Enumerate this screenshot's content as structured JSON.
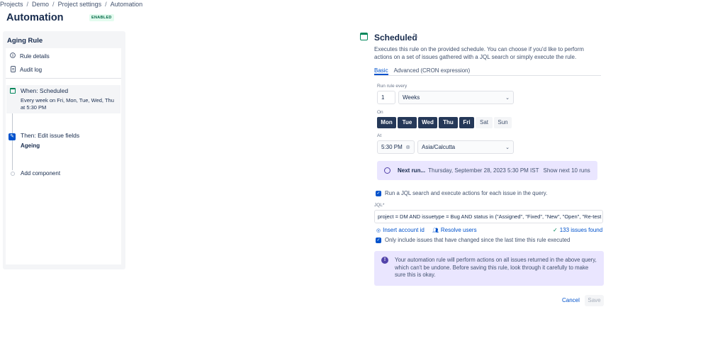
{
  "breadcrumb": {
    "items": [
      "Projects",
      "Demo",
      "Project settings",
      "Automation"
    ]
  },
  "page": {
    "title": "Automation",
    "status_badge": "ENABLED"
  },
  "sidebar": {
    "title": "Aging Rule",
    "items": [
      {
        "label": "Rule details",
        "icon": "info-icon"
      },
      {
        "label": "Audit log",
        "icon": "document-icon"
      }
    ],
    "trigger": {
      "title": "When: Scheduled",
      "description": "Every week on Fri, Mon, Tue, Wed, Thu at 5:30 PM",
      "icon": "calendar-icon",
      "color": "#00875a"
    },
    "action": {
      "title": "Then: Edit issue fields",
      "subtitle": "Ageing",
      "icon": "pencil-icon",
      "color": "#0052cc"
    },
    "add_component": "Add component"
  },
  "scheduled": {
    "title": "Scheduled",
    "description": "Executes this rule on the provided schedule. You can choose if you'd like to perform actions on a set of issues gathered with a JQL search or simply execute the rule.",
    "tabs": [
      {
        "label": "Basic",
        "active": true
      },
      {
        "label": "Advanced (CRON expression)",
        "active": false
      }
    ],
    "run_rule_every_label": "Run rule every",
    "interval_value": "1",
    "interval_unit": "Weeks",
    "on_label": "On",
    "days": [
      {
        "label": "Mon",
        "selected": true
      },
      {
        "label": "Tue",
        "selected": true
      },
      {
        "label": "Wed",
        "selected": true
      },
      {
        "label": "Thu",
        "selected": true
      },
      {
        "label": "Fri",
        "selected": true
      },
      {
        "label": "Sat",
        "selected": false
      },
      {
        "label": "Sun",
        "selected": false
      }
    ],
    "at_label": "At",
    "time_value": "5:30 PM",
    "timezone": "Asia/Calcutta",
    "next_run": {
      "label": "Next run...",
      "value": "Thursday, September 28, 2023 5:30 PM IST",
      "link": "Show next 10 runs"
    },
    "jql_checkbox_label": "Run a JQL search and execute actions for each issue in the query.",
    "jql_label": "JQL*",
    "jql_value": "project = DM AND issuetype = Bug AND status in (\"Assigned\", \"Fixed\", \"New\", \"Open\", \"Re-test f",
    "insert_account_id": "Insert account id",
    "resolve_users": "Resolve users",
    "issues_found": "133 issues found",
    "only_changed_label": "Only include issues that have changed since the last time this rule executed",
    "warning": "Your automation rule will perform actions on all issues returned in the above query, which can't be undone. Before saving this rule, look through it carefully to make sure this is okay.",
    "cancel": "Cancel",
    "save": "Save"
  },
  "colors": {
    "primary": "#0052cc",
    "success": "#00875a",
    "selected_day": "#253858",
    "info_bg": "#eae6ff",
    "info_icon": "#5243aa"
  }
}
